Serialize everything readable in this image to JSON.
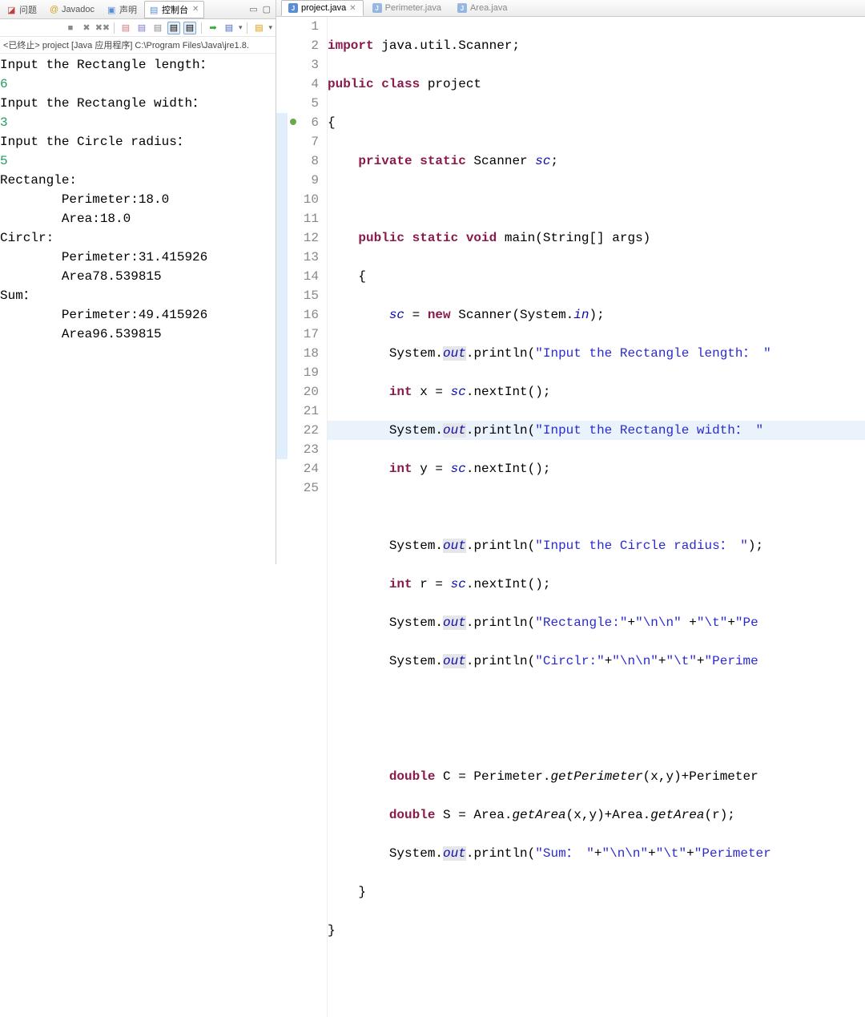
{
  "leftTabs": {
    "problems": "问题",
    "javadoc": "Javadoc",
    "declaration": "声明",
    "console": "控制台"
  },
  "status": "<已终止> project [Java 应用程序] C:\\Program Files\\Java\\jre1.8.",
  "console": {
    "l1": "Input the Rectangle length：",
    "l2": "6",
    "l3": "Input the Rectangle width：",
    "l4": "3",
    "l5": "Input the Circle radius：",
    "l6": "5",
    "l7": "Rectangle:",
    "l8": "",
    "l9": "\tPerimeter:18.0",
    "l10": "",
    "l11": "\tArea:18.0",
    "l12": "",
    "l13": "Circlr:",
    "l14": "",
    "l15": "\tPerimeter:31.415926",
    "l16": "",
    "l17": "\tArea78.539815",
    "l18": "",
    "l19": "Sum：",
    "l20": "",
    "l21": "\tPerimeter:49.415926",
    "l22": "",
    "l23": "\tArea96.539815"
  },
  "editorTabs": {
    "project": "project.java",
    "perimeter": "Perimeter.java",
    "area": "Area.java"
  },
  "code": {
    "l1": {
      "a": "import",
      "b": " java.util.Scanner;"
    },
    "l2": {
      "a": "public class",
      "b": " project"
    },
    "l3": "{",
    "l4": {
      "a": "    ",
      "b": "private static",
      "c": " Scanner ",
      "d": "sc",
      "e": ";"
    },
    "l5": "",
    "l6": {
      "a": "    ",
      "b": "public static void",
      "c": " main(String[] args)"
    },
    "l7": "    {",
    "l8": {
      "a": "        ",
      "b": "sc",
      "c": " = ",
      "d": "new",
      "e": " Scanner(System.",
      "f": "in",
      "g": ");"
    },
    "l9": {
      "a": "        System.",
      "b": "out",
      "c": ".println(",
      "d": "\"Input the Rectangle length： \""
    },
    "l10": {
      "a": "        ",
      "b": "int",
      "c": " x = ",
      "d": "sc",
      "e": ".nextInt();"
    },
    "l11": {
      "a": "        System.",
      "b": "out",
      "c": ".println(",
      "d": "\"Input the Rectangle width： \""
    },
    "l12": {
      "a": "        ",
      "b": "int",
      "c": " y = ",
      "d": "sc",
      "e": ".nextInt();"
    },
    "l13": "",
    "l14": {
      "a": "        System.",
      "b": "out",
      "c": ".println(",
      "d": "\"Input the Circle radius： \"",
      "e": ");"
    },
    "l15": {
      "a": "        ",
      "b": "int",
      "c": " r = ",
      "d": "sc",
      "e": ".nextInt();"
    },
    "l16": {
      "a": "        System.",
      "b": "out",
      "c": ".println(",
      "d": "\"Rectangle:\"",
      "e": "+",
      "f": "\"\\n\\n\"",
      "g": " +",
      "h": "\"\\t\"",
      "i": "+",
      "j": "\"Pe"
    },
    "l17": {
      "a": "        System.",
      "b": "out",
      "c": ".println(",
      "d": "\"Circlr:\"",
      "e": "+",
      "f": "\"\\n\\n\"",
      "g": "+",
      "h": "\"\\t\"",
      "i": "+",
      "j": "\"Perime"
    },
    "l18": "",
    "l19": "",
    "l20": {
      "a": "        ",
      "b": "double",
      "c": " C = Perimeter.",
      "d": "getPerimeter",
      "e": "(x,y)+Perimeter"
    },
    "l21": {
      "a": "        ",
      "b": "double",
      "c": " S = Area.",
      "d": "getArea",
      "e": "(x,y)+Area.",
      "f": "getArea",
      "g": "(r);"
    },
    "l22": {
      "a": "        System.",
      "b": "out",
      "c": ".println(",
      "d": "\"Sum： \"",
      "e": "+",
      "f": "\"\\n\\n\"",
      "g": "+",
      "h": "\"\\t\"",
      "i": "+",
      "j": "\"Perimeter"
    },
    "l23": "    }",
    "l24": "}",
    "l25": ""
  },
  "gutter": [
    "1",
    "2",
    "3",
    "4",
    "5",
    "6",
    "7",
    "8",
    "9",
    "10",
    "11",
    "12",
    "13",
    "14",
    "15",
    "16",
    "17",
    "18",
    "19",
    "20",
    "21",
    "22",
    "23",
    "24",
    "25"
  ]
}
